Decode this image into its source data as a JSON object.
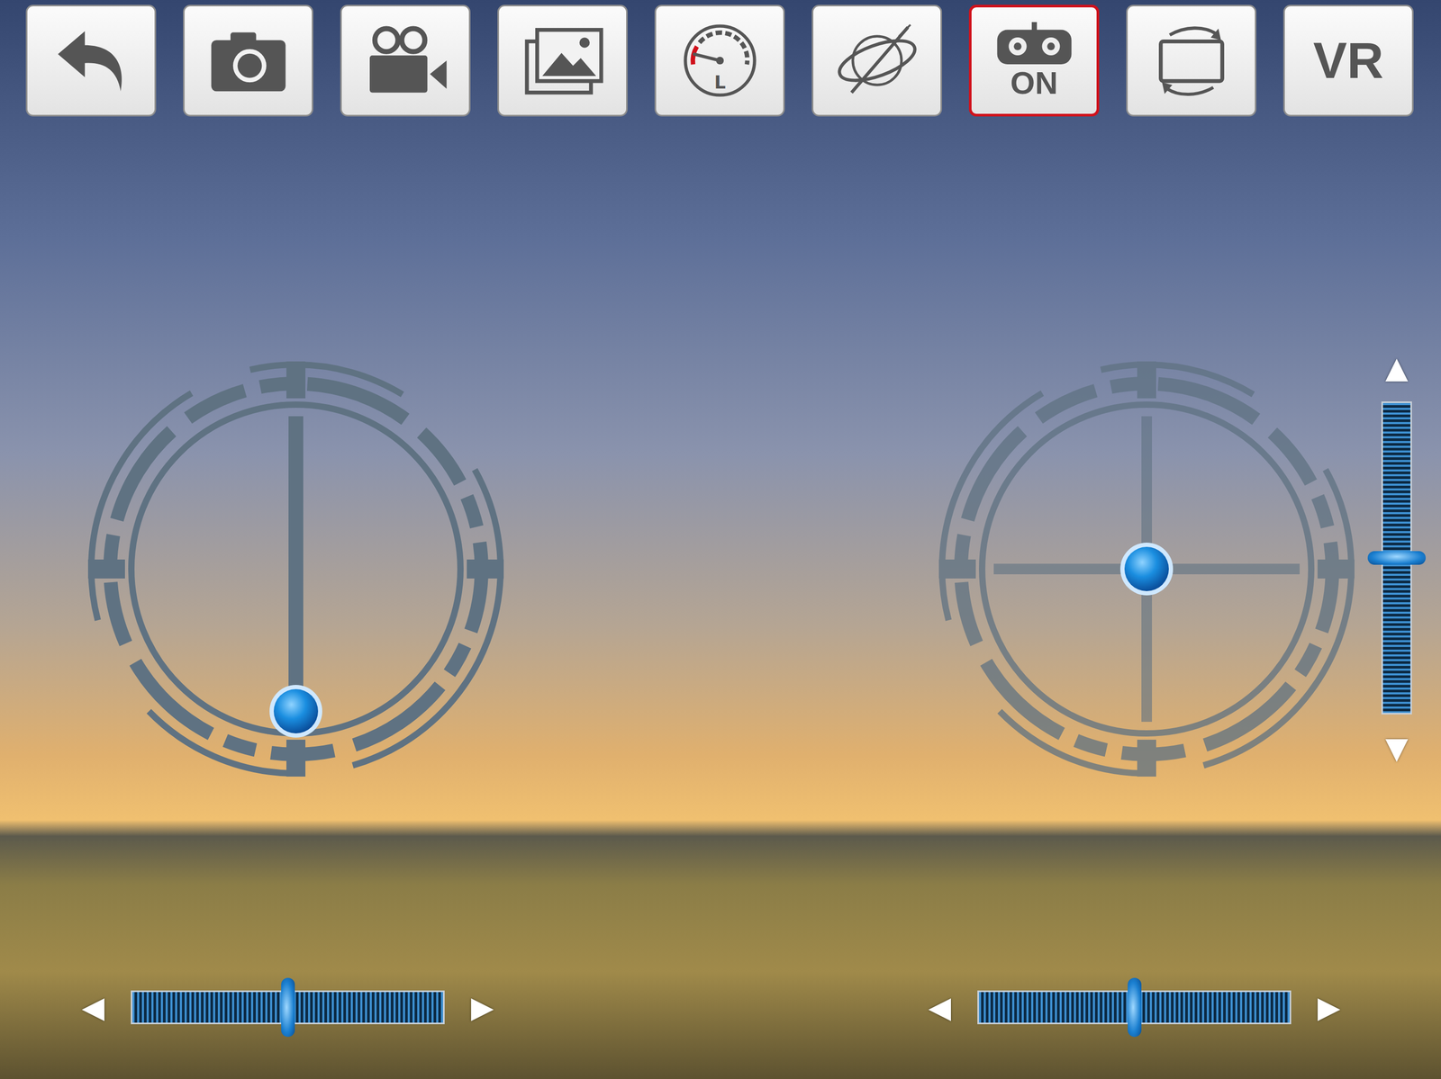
{
  "toolbar": [
    {
      "kind": "back",
      "text": "",
      "selected": false
    },
    {
      "kind": "photo",
      "text": "",
      "selected": false
    },
    {
      "kind": "video",
      "text": "",
      "selected": false
    },
    {
      "kind": "gallery",
      "text": "",
      "selected": false
    },
    {
      "kind": "speed",
      "text": "L",
      "selected": false
    },
    {
      "kind": "gyro",
      "text": "",
      "selected": false
    },
    {
      "kind": "controller",
      "text": "ON",
      "selected": true
    },
    {
      "kind": "rotate",
      "text": "",
      "selected": false
    },
    {
      "kind": "vr",
      "text": "VR",
      "selected": false
    }
  ],
  "joysticks": [
    {
      "kind": "throttle",
      "x": 0.5,
      "y": 0.0
    },
    {
      "kind": "cross",
      "x": 0.5,
      "y": 0.5
    }
  ],
  "throttle_slider": {
    "level": 0.5,
    "up": "▲",
    "down": "▼"
  },
  "trims": [
    {
      "level": 0.5,
      "left": "◀",
      "right": "▶"
    },
    {
      "level": 0.5,
      "left": "◀",
      "right": "▶"
    }
  ]
}
